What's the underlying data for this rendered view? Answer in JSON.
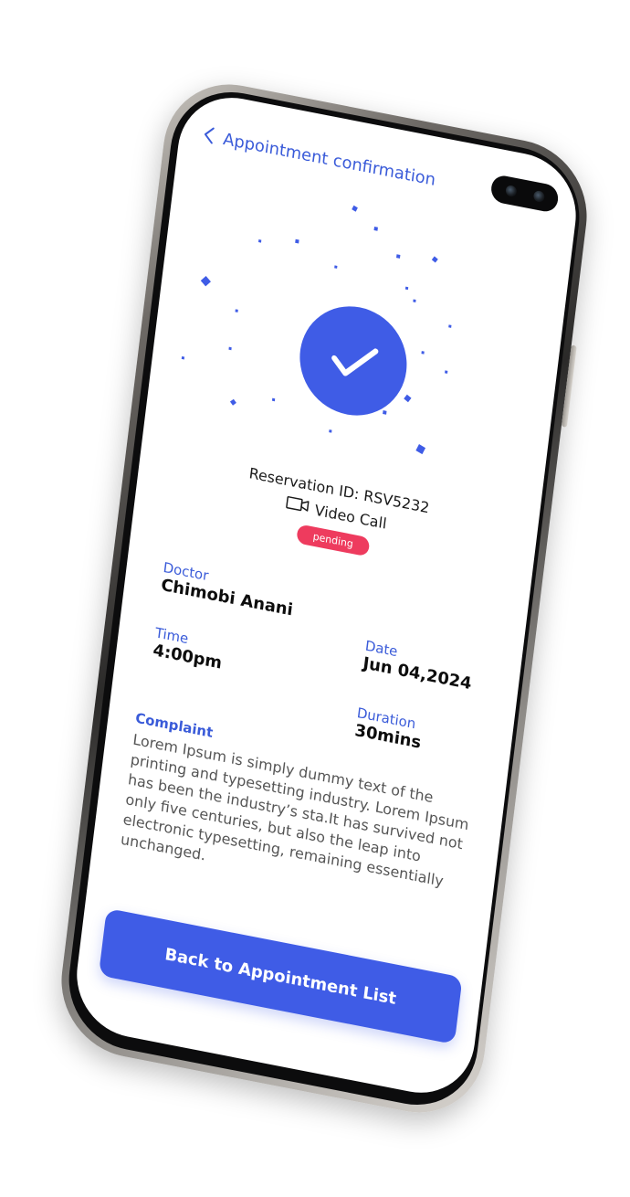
{
  "header": {
    "back_icon": "chevron-left-icon",
    "title": "Appointment confirmation"
  },
  "confirmation": {
    "check_icon": "check-icon",
    "accent_color": "#3f5ce6"
  },
  "appointment": {
    "reservation_text": "Reservation ID: RSV5232",
    "call_icon": "video-camera-icon",
    "call_type": "Video Call",
    "status": "pending",
    "status_color": "#ee3b5e"
  },
  "details": {
    "doctor_label": "Doctor",
    "doctor_name": "Chimobi Anani",
    "date_label": "Date",
    "date_value": "Jun 04,2024",
    "time_label": "Time",
    "time_value": "4:00pm",
    "duration_label": "Duration",
    "duration_value": "30mins"
  },
  "complaint": {
    "label": "Complaint",
    "text": "Lorem Ipsum is simply dummy text of the printing and typesetting industry. Lorem Ipsum has been the industry’s sta.It has survived not only five centuries, but also the leap into electronic typesetting, remaining essentially unchanged."
  },
  "actions": {
    "back_to_list": "Back to Appointment List"
  }
}
